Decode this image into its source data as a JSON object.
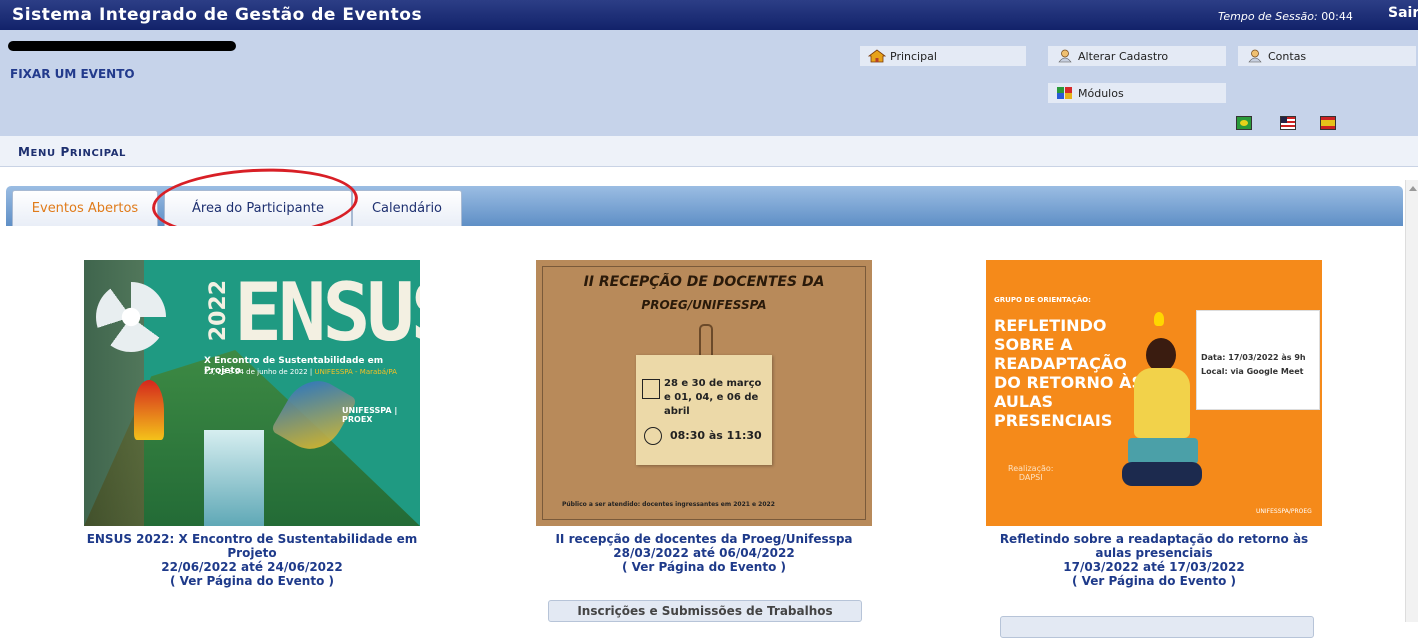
{
  "topbar": {
    "title": "Sistema Integrado de Gestão de Eventos",
    "session_label": "Tempo de Sessão:",
    "session_value": "00:44",
    "logout": "Sair"
  },
  "header": {
    "fixar": "FIXAR UM EVENTO",
    "links": {
      "principal": "Principal",
      "alterar_cadastro": "Alterar Cadastro",
      "contas": "Contas",
      "modulos": "Módulos"
    },
    "languages": [
      "Português",
      "English",
      "Español"
    ]
  },
  "menu": {
    "label": "Menu Principal"
  },
  "tabs": [
    {
      "label": "Eventos Abertos",
      "active": true
    },
    {
      "label": "Área do Participante",
      "active": false
    },
    {
      "label": "Calendário",
      "active": false
    }
  ],
  "events": [
    {
      "title": "ENSUS 2022: X Encontro de Sustentabilidade em Projeto",
      "dates": "22/06/2022 até 24/06/2022",
      "link": "( Ver Página do Evento )",
      "poster": {
        "big": "ENSUS",
        "year": "2022",
        "subtitle": "X Encontro de Sustentabilidade em Projeto",
        "dates_text": "22, 23 e 24 de junho de 2022 |",
        "place": "UNIFESSPA - Marabá/PA",
        "logo": "UNIFESSPA | PROEX"
      }
    },
    {
      "title": "II recepção de docentes da Proeg/Unifesspa",
      "dates": "28/03/2022 até 06/04/2022",
      "link": "( Ver Página do Evento )",
      "button": "Inscrições e Submissões de Trabalhos",
      "poster": {
        "line1": "II RECEPÇÃO DE DOCENTES DA",
        "line2": "PROEG/UNIFESSPA",
        "dates_text": "28 e 30 de março e 01, 04, e 06 de abril",
        "time": "08:30 às 11:30",
        "footer": "Público a ser atendido: docentes ingressantes em 2021 e 2022"
      }
    },
    {
      "title": "Refletindo sobre a readaptação do retorno às aulas presenciais",
      "dates": "17/03/2022 até 17/03/2022",
      "link": "( Ver Página do Evento )",
      "poster": {
        "group": "GRUPO DE ORIENTAÇÃO:",
        "headline": "REFLETINDO SOBRE A READAPTAÇÃO DO RETORNO ÀS AULAS PRESENCIAIS",
        "data": "Data: 17/03/2022 às 9h",
        "local": "Local: via Google Meet",
        "realizacao": "Realização:",
        "org": "DAPSI",
        "logo": "UNIFESSPA/PROEG"
      }
    }
  ],
  "colors": {
    "topbar": "#1a2a78",
    "header": "#c6d3ea",
    "tab_active": "#e07b1a",
    "link": "#1e3a8a",
    "annotation": "#d81f26"
  }
}
